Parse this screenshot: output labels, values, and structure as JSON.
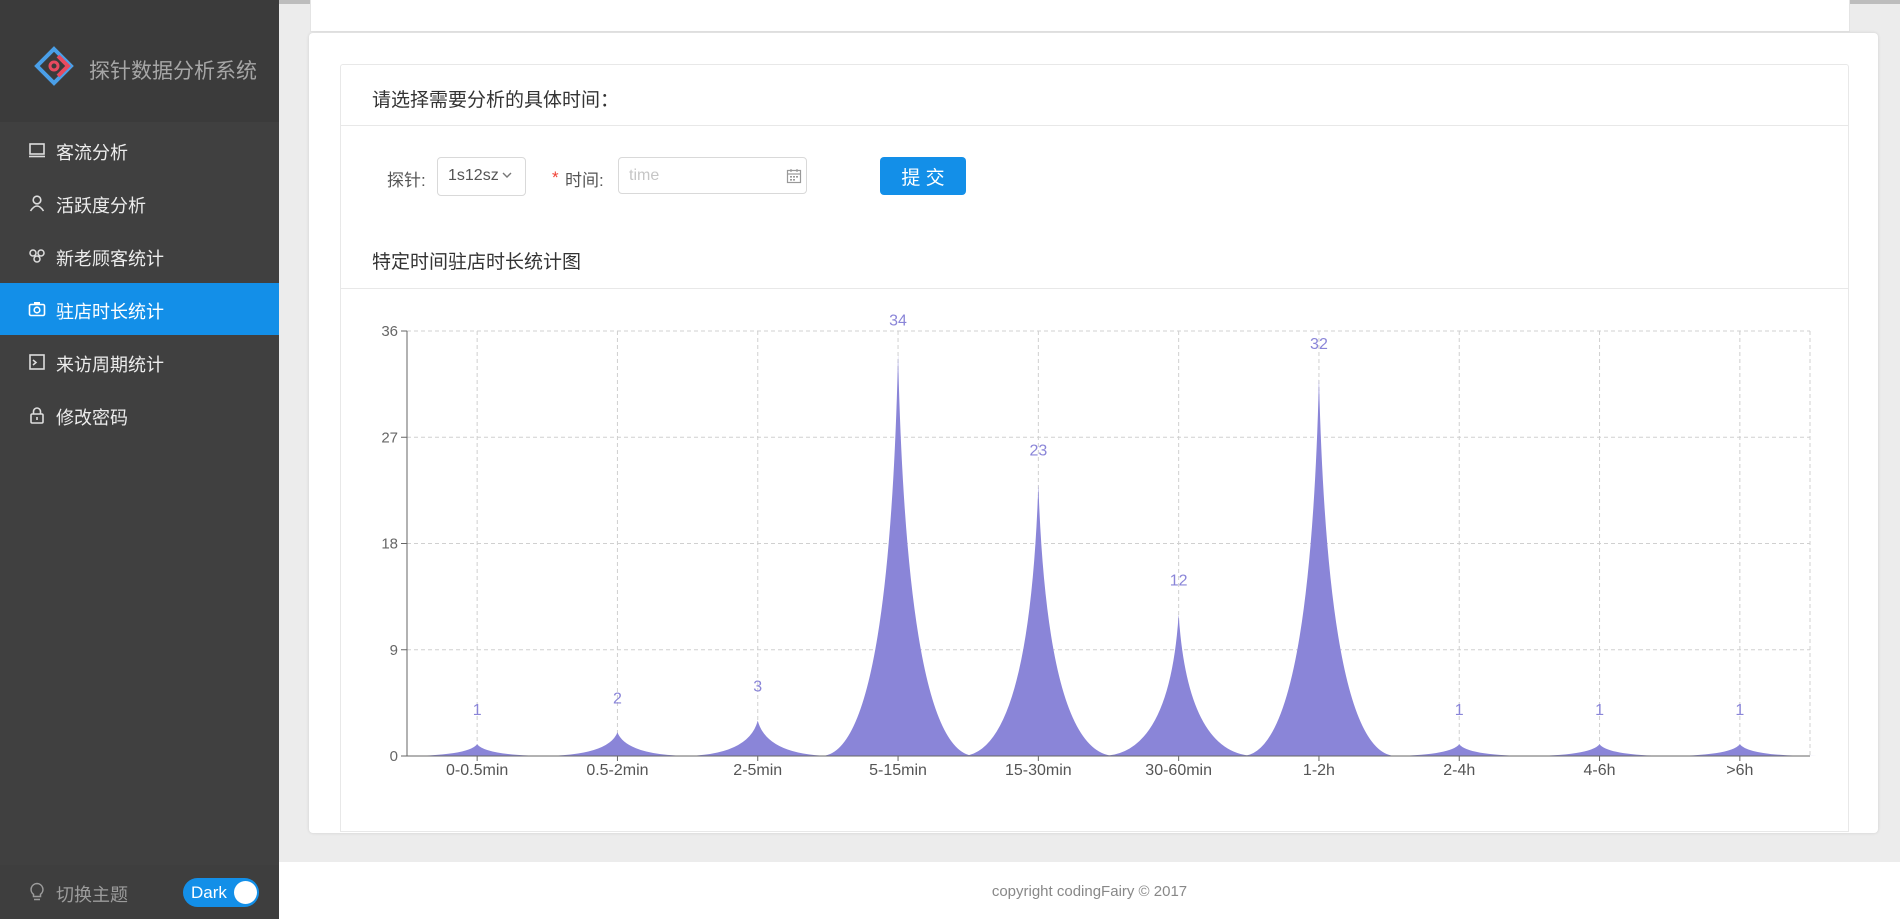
{
  "app": {
    "title": "探针数据分析系统"
  },
  "sidebar": {
    "items": [
      {
        "label": "客流分析",
        "icon": "monitor-icon"
      },
      {
        "label": "活跃度分析",
        "icon": "user-icon"
      },
      {
        "label": "新老顾客统计",
        "icon": "team-icon"
      },
      {
        "label": "驻店时长统计",
        "icon": "camera-icon",
        "active": true
      },
      {
        "label": "来访周期统计",
        "icon": "code-icon"
      },
      {
        "label": "修改密码",
        "icon": "lock-icon"
      }
    ],
    "theme_label": "切换主题",
    "theme_toggle": "Dark"
  },
  "form": {
    "title": "请选择需要分析的具体时间：",
    "probe_label": "探针:",
    "probe_value": "1s12sz",
    "time_required_mark": "*",
    "time_label": "时间:",
    "time_placeholder": "time",
    "submit_label": "提 交"
  },
  "chart_card": {
    "title": "特定时间驻店时长统计图"
  },
  "chart_data": {
    "type": "area",
    "title": "特定时间驻店时长统计图",
    "categories": [
      "0-0.5min",
      "0.5-2min",
      "2-5min",
      "5-15min",
      "15-30min",
      "30-60min",
      "1-2h",
      "2-4h",
      "4-6h",
      ">6h"
    ],
    "values": [
      1,
      2,
      3,
      34,
      23,
      12,
      32,
      1,
      1,
      1
    ],
    "ylim": [
      0,
      36
    ],
    "yticks": [
      0,
      9,
      18,
      27,
      36
    ],
    "grid": true,
    "colors": {
      "fill": "#8a85d8",
      "label": "#8a85d8"
    }
  },
  "footer": {
    "text": "copyright codingFairy © 2017"
  },
  "colors": {
    "accent": "#138fe8",
    "sidebar": "#404040"
  }
}
